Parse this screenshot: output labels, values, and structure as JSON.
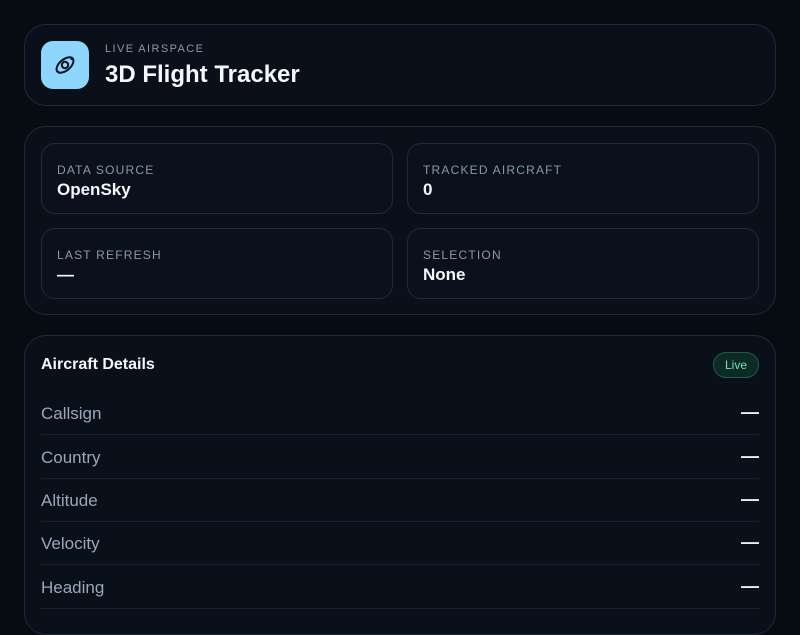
{
  "header": {
    "eyebrow": "LIVE AIRSPACE",
    "title": "3D Flight Tracker",
    "logo_icon": "orbit-icon",
    "accent": "#8fd6ff"
  },
  "stats": [
    {
      "label": "DATA SOURCE",
      "value": "OpenSky"
    },
    {
      "label": "TRACKED AIRCRAFT",
      "value": "0"
    },
    {
      "label": "LAST REFRESH",
      "value": "—"
    },
    {
      "label": "SELECTION",
      "value": "None"
    }
  ],
  "details": {
    "title": "Aircraft Details",
    "badge": "Live",
    "badge_color": "#6fe3b8",
    "rows": [
      {
        "label": "Callsign",
        "value": "—"
      },
      {
        "label": "Country",
        "value": "—"
      },
      {
        "label": "Altitude",
        "value": "—"
      },
      {
        "label": "Velocity",
        "value": "—"
      },
      {
        "label": "Heading",
        "value": "—"
      }
    ]
  }
}
